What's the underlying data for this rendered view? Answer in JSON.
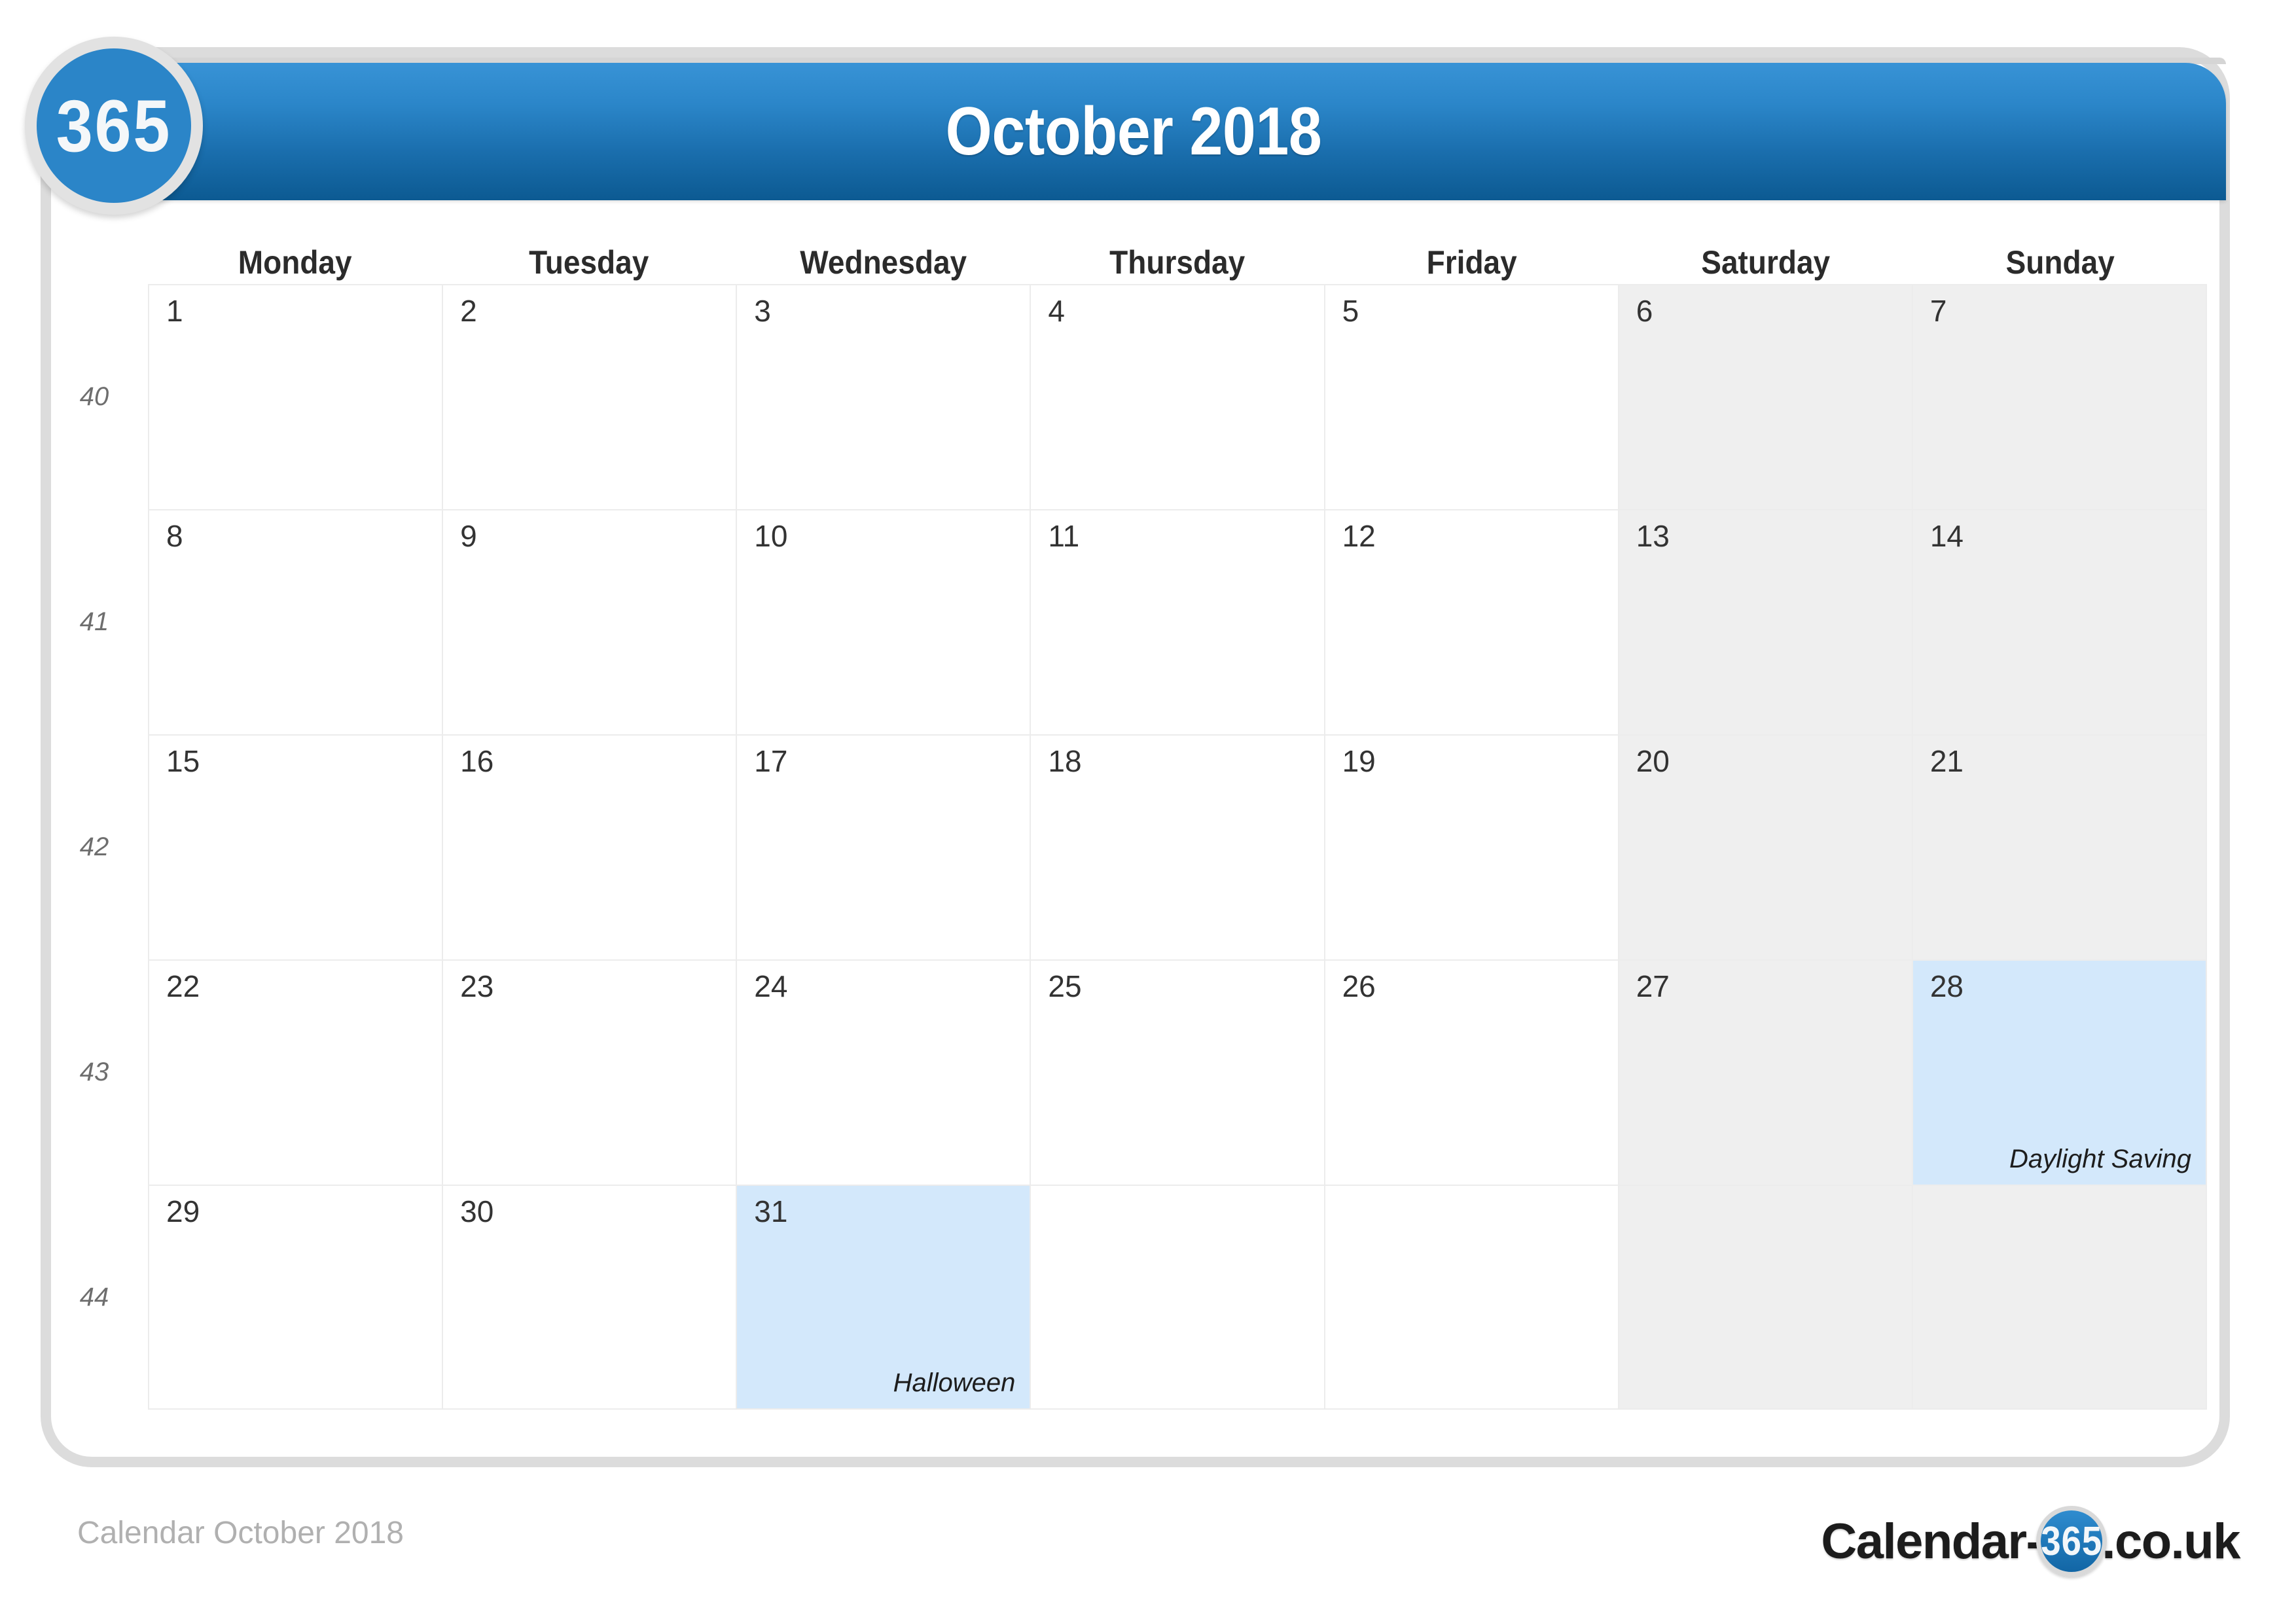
{
  "brand": {
    "badge_label": "365",
    "watermark_text": "365"
  },
  "header": {
    "title": "October 2018"
  },
  "calendar": {
    "weekday_headers": [
      "Monday",
      "Tuesday",
      "Wednesday",
      "Thursday",
      "Friday",
      "Saturday",
      "Sunday"
    ],
    "weeks": [
      {
        "week_number": "40",
        "days": [
          {
            "num": "1",
            "weekend": false,
            "highlight": false,
            "event": ""
          },
          {
            "num": "2",
            "weekend": false,
            "highlight": false,
            "event": ""
          },
          {
            "num": "3",
            "weekend": false,
            "highlight": false,
            "event": ""
          },
          {
            "num": "4",
            "weekend": false,
            "highlight": false,
            "event": ""
          },
          {
            "num": "5",
            "weekend": false,
            "highlight": false,
            "event": ""
          },
          {
            "num": "6",
            "weekend": true,
            "highlight": false,
            "event": ""
          },
          {
            "num": "7",
            "weekend": true,
            "highlight": false,
            "event": ""
          }
        ]
      },
      {
        "week_number": "41",
        "days": [
          {
            "num": "8",
            "weekend": false,
            "highlight": false,
            "event": ""
          },
          {
            "num": "9",
            "weekend": false,
            "highlight": false,
            "event": ""
          },
          {
            "num": "10",
            "weekend": false,
            "highlight": false,
            "event": ""
          },
          {
            "num": "11",
            "weekend": false,
            "highlight": false,
            "event": ""
          },
          {
            "num": "12",
            "weekend": false,
            "highlight": false,
            "event": ""
          },
          {
            "num": "13",
            "weekend": true,
            "highlight": false,
            "event": ""
          },
          {
            "num": "14",
            "weekend": true,
            "highlight": false,
            "event": ""
          }
        ]
      },
      {
        "week_number": "42",
        "days": [
          {
            "num": "15",
            "weekend": false,
            "highlight": false,
            "event": ""
          },
          {
            "num": "16",
            "weekend": false,
            "highlight": false,
            "event": ""
          },
          {
            "num": "17",
            "weekend": false,
            "highlight": false,
            "event": ""
          },
          {
            "num": "18",
            "weekend": false,
            "highlight": false,
            "event": ""
          },
          {
            "num": "19",
            "weekend": false,
            "highlight": false,
            "event": ""
          },
          {
            "num": "20",
            "weekend": true,
            "highlight": false,
            "event": ""
          },
          {
            "num": "21",
            "weekend": true,
            "highlight": false,
            "event": ""
          }
        ]
      },
      {
        "week_number": "43",
        "days": [
          {
            "num": "22",
            "weekend": false,
            "highlight": false,
            "event": ""
          },
          {
            "num": "23",
            "weekend": false,
            "highlight": false,
            "event": ""
          },
          {
            "num": "24",
            "weekend": false,
            "highlight": false,
            "event": ""
          },
          {
            "num": "25",
            "weekend": false,
            "highlight": false,
            "event": ""
          },
          {
            "num": "26",
            "weekend": false,
            "highlight": false,
            "event": ""
          },
          {
            "num": "27",
            "weekend": true,
            "highlight": false,
            "event": ""
          },
          {
            "num": "28",
            "weekend": true,
            "highlight": true,
            "event": "Daylight Saving"
          }
        ]
      },
      {
        "week_number": "44",
        "days": [
          {
            "num": "29",
            "weekend": false,
            "highlight": false,
            "event": ""
          },
          {
            "num": "30",
            "weekend": false,
            "highlight": false,
            "event": ""
          },
          {
            "num": "31",
            "weekend": false,
            "highlight": true,
            "event": "Halloween"
          },
          {
            "num": "",
            "weekend": false,
            "highlight": false,
            "event": ""
          },
          {
            "num": "",
            "weekend": false,
            "highlight": false,
            "event": ""
          },
          {
            "num": "",
            "weekend": true,
            "highlight": false,
            "event": ""
          },
          {
            "num": "",
            "weekend": true,
            "highlight": false,
            "event": ""
          }
        ]
      }
    ]
  },
  "footer": {
    "caption": "Calendar October 2018",
    "logo_prefix": "Calendar-",
    "logo_circle": "365",
    "logo_suffix": ".co.uk"
  },
  "colors": {
    "brand_blue": "#2b85c8",
    "header_gradient_top": "#3893d6",
    "header_gradient_bottom": "#0c5a92",
    "weekend_bg": "#efefef",
    "highlight_bg": "#d3e8fb",
    "frame_border": "#dcdcdc",
    "grid_line": "#ececec",
    "footer_text": "#b0b0b0"
  }
}
